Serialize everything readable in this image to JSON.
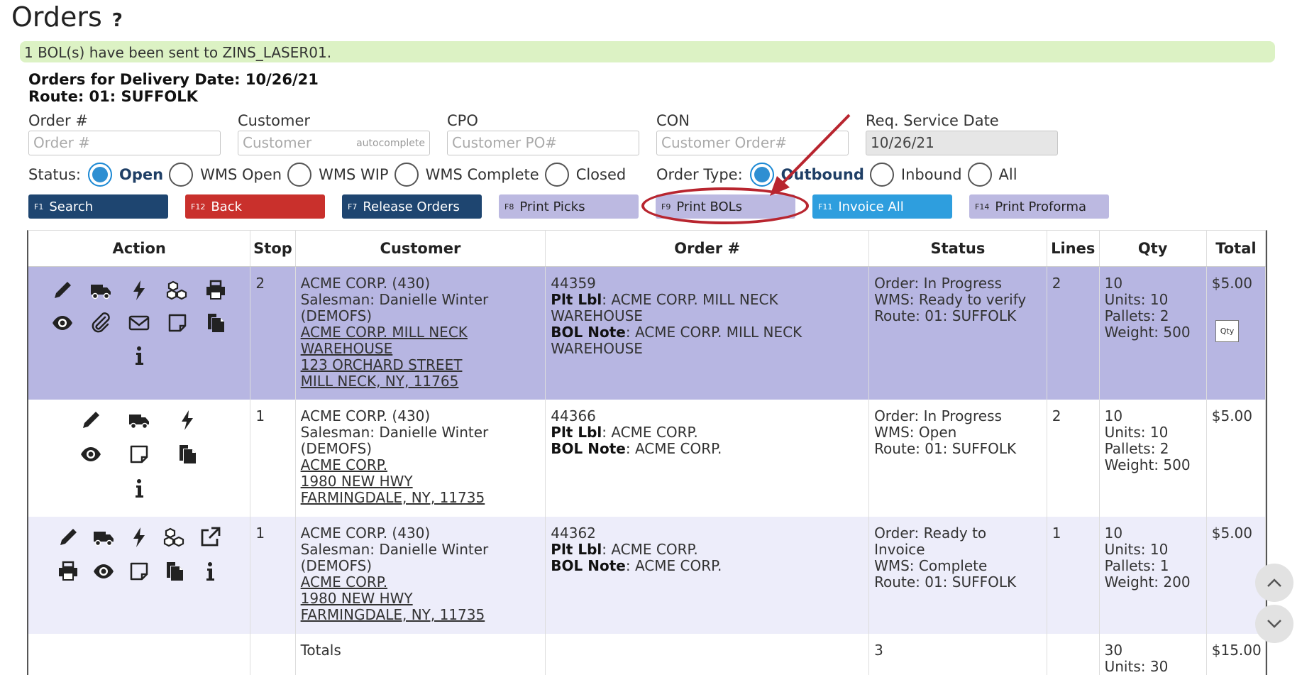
{
  "page": {
    "title": "Orders",
    "help_icon": "?"
  },
  "alert": {
    "message": "1 BOL(s) have been sent to ZINS_LASER01."
  },
  "heading": {
    "line1": "Orders for Delivery Date: 10/26/21",
    "line2": "Route: 01: SUFFOLK"
  },
  "filters": {
    "order": {
      "label": "Order #",
      "placeholder": "Order #",
      "value": ""
    },
    "customer": {
      "label": "Customer",
      "placeholder": "Customer",
      "hint": "autocomplete",
      "value": ""
    },
    "cpo": {
      "label": "CPO",
      "placeholder": "Customer PO#",
      "value": ""
    },
    "con": {
      "label": "CON",
      "placeholder": "Customer Order#",
      "value": ""
    },
    "req_date": {
      "label": "Req. Service Date",
      "value": "10/26/21"
    }
  },
  "status_filter": {
    "label": "Status:",
    "options": [
      "Open",
      "WMS Open",
      "WMS WIP",
      "WMS Complete",
      "Closed"
    ],
    "selected": "Open"
  },
  "order_type_filter": {
    "label": "Order Type:",
    "options": [
      "Outbound",
      "Inbound",
      "All"
    ],
    "selected": "Outbound"
  },
  "buttons": [
    {
      "key": "F1",
      "label": "Search",
      "style": "dark"
    },
    {
      "key": "F12",
      "label": "Back",
      "style": "red"
    },
    {
      "key": "F7",
      "label": "Release Orders",
      "style": "dark"
    },
    {
      "key": "F8",
      "label": "Print Picks",
      "style": "lav"
    },
    {
      "key": "F9",
      "label": "Print BOLs",
      "style": "lav"
    },
    {
      "key": "F11",
      "label": "Invoice All",
      "style": "blue"
    },
    {
      "key": "F14",
      "label": "Print Proforma",
      "style": "lav"
    }
  ],
  "table": {
    "headers": [
      "Action",
      "Stop",
      "Customer",
      "Order #",
      "Status",
      "Lines",
      "Qty",
      "Total"
    ],
    "rows": [
      {
        "icons": [
          "pencil-icon",
          "truck-icon",
          "bolt-icon",
          "boxes-icon",
          "printer-icon",
          "eye-icon",
          "paperclip-icon",
          "envelope-icon",
          "note-icon",
          "copy-icon",
          "info-icon"
        ],
        "stop": "2",
        "customer_name": "ACME CORP. (430)",
        "salesman": "Salesman: Danielle Winter",
        "salesman_code": "(DEMOFS)",
        "addr1": "ACME CORP. MILL NECK",
        "addr2": "WAREHOUSE",
        "addr3": "123 ORCHARD STREET",
        "addr4": "MILL NECK, NY, 11765",
        "order_no": "44359",
        "plt_lbl_key": "Plt Lbl",
        "plt_lbl": ": ACME CORP. MILL NECK WAREHOUSE",
        "bol_note_key": "BOL Note",
        "bol_note": ": ACME CORP. MILL NECK WAREHOUSE",
        "status_order": "Order: In Progress",
        "status_wms": "WMS: Ready to verify",
        "status_route": "Route: 01: SUFFOLK",
        "lines": "2",
        "qty": "10",
        "units": "Units: 10",
        "pallets": "Pallets: 2",
        "weight": "Weight: 500",
        "total": "$5.00",
        "qty_button": "Qty"
      },
      {
        "icons": [
          "pencil-icon",
          "truck-icon",
          "bolt-icon",
          "eye-icon",
          "note-icon",
          "copy-icon",
          "info-icon"
        ],
        "stop": "1",
        "customer_name": "ACME CORP. (430)",
        "salesman": "Salesman: Danielle Winter",
        "salesman_code": "(DEMOFS)",
        "addr1": "ACME CORP.",
        "addr2": "",
        "addr3": "1980 NEW HWY",
        "addr4": "FARMINGDALE, NY, 11735",
        "order_no": "44366",
        "plt_lbl_key": "Plt Lbl",
        "plt_lbl": ": ACME CORP.",
        "bol_note_key": "BOL Note",
        "bol_note": ": ACME CORP.",
        "status_order": "Order: In Progress",
        "status_wms": "WMS: Open",
        "status_route": "Route: 01: SUFFOLK",
        "lines": "2",
        "qty": "10",
        "units": "Units: 10",
        "pallets": "Pallets: 2",
        "weight": "Weight: 500",
        "total": "$5.00"
      },
      {
        "icons": [
          "pencil-icon",
          "truck-icon",
          "bolt-icon",
          "boxes-icon",
          "external-link-icon",
          "printer-icon",
          "eye-icon",
          "note-icon",
          "copy-icon",
          "info-icon"
        ],
        "stop": "1",
        "customer_name": "ACME CORP. (430)",
        "salesman": "Salesman: Danielle Winter",
        "salesman_code": "(DEMOFS)",
        "addr1": "ACME CORP.",
        "addr2": "",
        "addr3": "1980 NEW HWY",
        "addr4": "FARMINGDALE, NY, 11735",
        "order_no": "44362",
        "plt_lbl_key": "Plt Lbl",
        "plt_lbl": ": ACME CORP.",
        "bol_note_key": "BOL Note",
        "bol_note": ": ACME CORP.",
        "status_order": "Order: Ready to Invoice",
        "status_wms": "WMS: Complete",
        "status_route": "Route: 01: SUFFOLK",
        "lines": "1",
        "qty": "10",
        "units": "Units: 10",
        "pallets": "Pallets: 1",
        "weight": "Weight: 200",
        "total": "$5.00"
      }
    ],
    "totals": {
      "label": "Totals",
      "lines": "3",
      "qty": "30",
      "units": "Units: 30",
      "total": "$15.00"
    }
  },
  "colors": {
    "annotation": "#b8252f",
    "row_highlight": "#b7b6e2",
    "alert_bg": "#dcf2c4"
  }
}
